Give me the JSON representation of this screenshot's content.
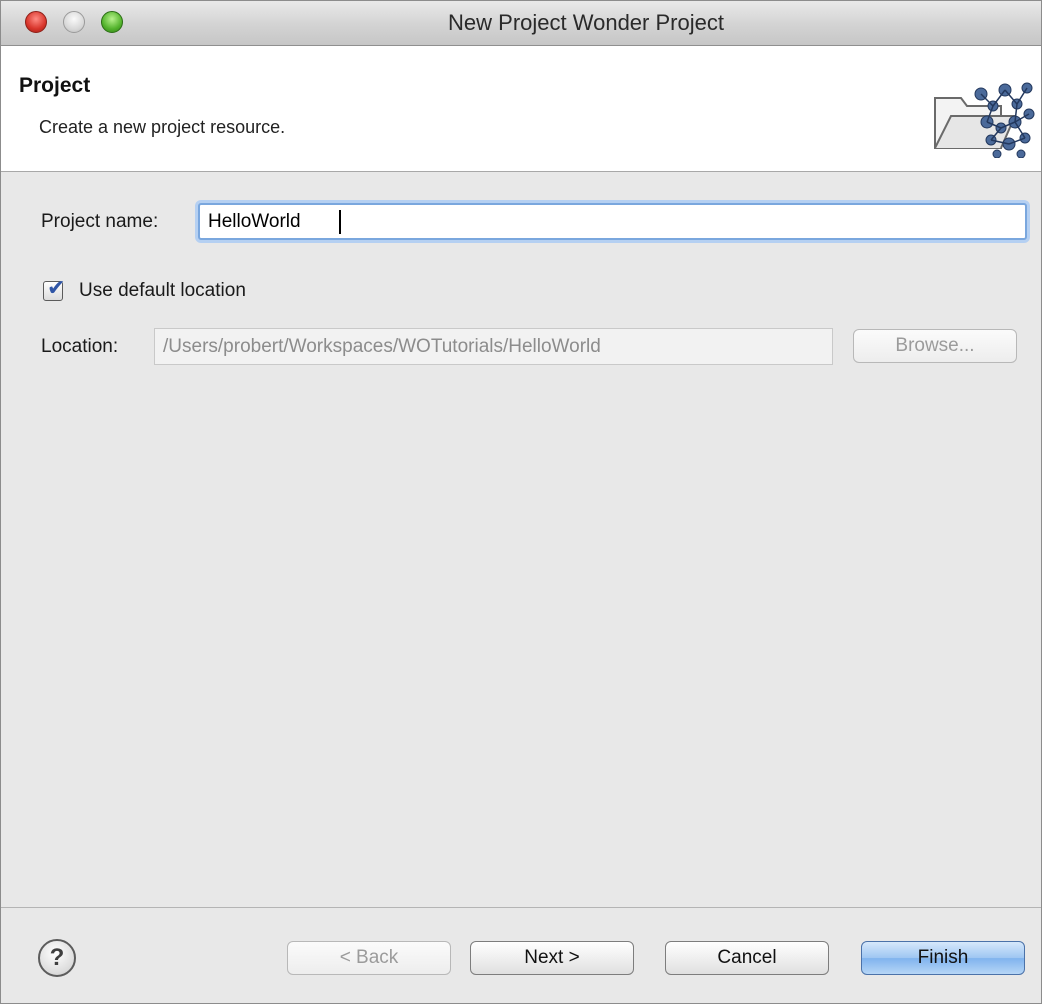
{
  "window": {
    "title": "New Project Wonder Project"
  },
  "header": {
    "title": "Project",
    "description": "Create a new project resource.",
    "icon": "wonder-wizard-icon"
  },
  "form": {
    "project_name_label": "Project name:",
    "project_name_value": "HelloWorld",
    "use_default_location_label": "Use default location",
    "use_default_location_checked": true,
    "location_label": "Location:",
    "location_value": "/Users/probert/Workspaces/WOTutorials/HelloWorld",
    "browse_label": "Browse..."
  },
  "footer": {
    "help_icon": "question-mark",
    "back_label": "< Back",
    "next_label": "Next >",
    "cancel_label": "Cancel",
    "finish_label": "Finish"
  },
  "colors": {
    "focus_ring": "#7aa7de",
    "default_button": "#80b3ee",
    "close_button": "#d8352b",
    "zoom_button": "#53b32c"
  }
}
